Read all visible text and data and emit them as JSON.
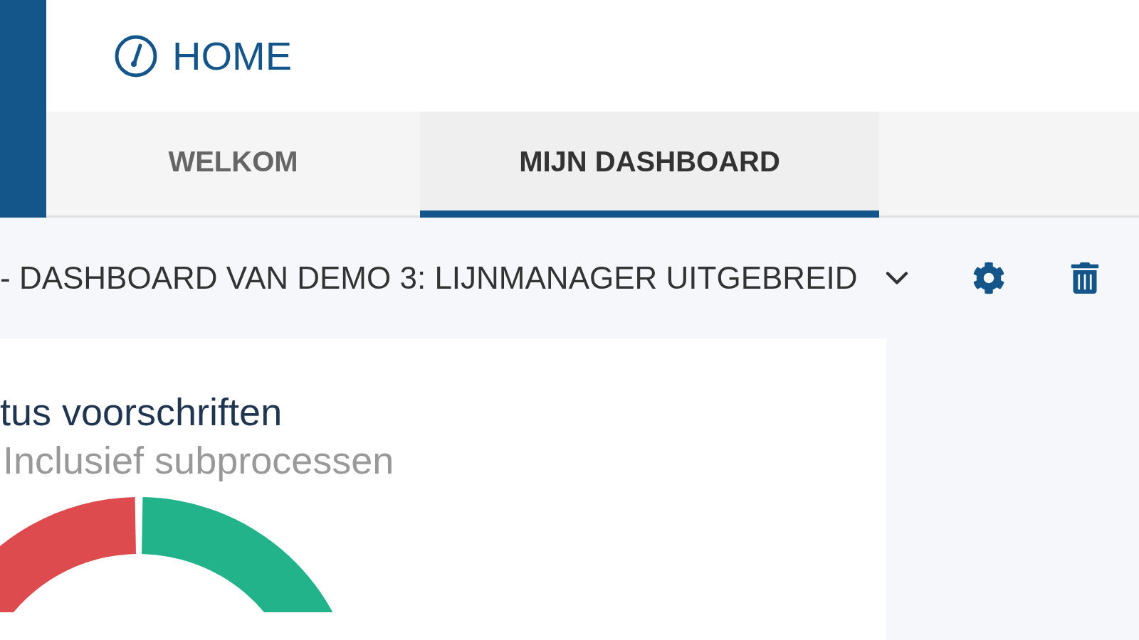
{
  "header": {
    "title": "HOME"
  },
  "tabs": [
    {
      "label": "WELKOM",
      "selected": false
    },
    {
      "label": "MIJN DASHBOARD",
      "selected": true
    }
  ],
  "dashboard": {
    "title": "- DASHBOARD VAN DEMO 3: LIJNMANAGER UITGEBREID"
  },
  "card": {
    "title": "tus voorschriften",
    "subtitle": "Inclusief subprocessen"
  }
}
